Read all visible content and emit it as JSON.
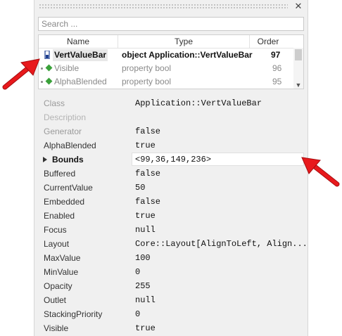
{
  "panel": {
    "close_icon": "close-icon",
    "search_placeholder": "Search ..."
  },
  "list": {
    "columns": {
      "name": "Name",
      "type": "Type",
      "order": "Order"
    },
    "rows": [
      {
        "name": "VertValueBar",
        "type": "object Application::VertValueBar",
        "order": "97"
      },
      {
        "name": "Visible",
        "type": "property bool",
        "order": "96"
      },
      {
        "name": "AlphaBlended",
        "type": "property bool",
        "order": "95"
      }
    ]
  },
  "properties": [
    {
      "name": "Class",
      "value": "Application::VertValueBar"
    },
    {
      "name": "Description",
      "value": ""
    },
    {
      "name": "Generator",
      "value": "false"
    },
    {
      "name": "AlphaBlended",
      "value": "true"
    },
    {
      "name": "Bounds",
      "value": "<99,36,149,236>"
    },
    {
      "name": "Buffered",
      "value": "false"
    },
    {
      "name": "CurrentValue",
      "value": "50"
    },
    {
      "name": "Embedded",
      "value": "false"
    },
    {
      "name": "Enabled",
      "value": "true"
    },
    {
      "name": "Focus",
      "value": "null"
    },
    {
      "name": "Layout",
      "value": "Core::Layout[AlignToLeft, Align..."
    },
    {
      "name": "MaxValue",
      "value": "100"
    },
    {
      "name": "MinValue",
      "value": "0"
    },
    {
      "name": "Opacity",
      "value": "255"
    },
    {
      "name": "Outlet",
      "value": "null"
    },
    {
      "name": "StackingPriority",
      "value": "0"
    },
    {
      "name": "Visible",
      "value": "true"
    }
  ],
  "colors": {
    "annotation_arrow": "#e8191c",
    "property_icon": "#3aa13a",
    "panel_background": "#f0f0f0"
  }
}
